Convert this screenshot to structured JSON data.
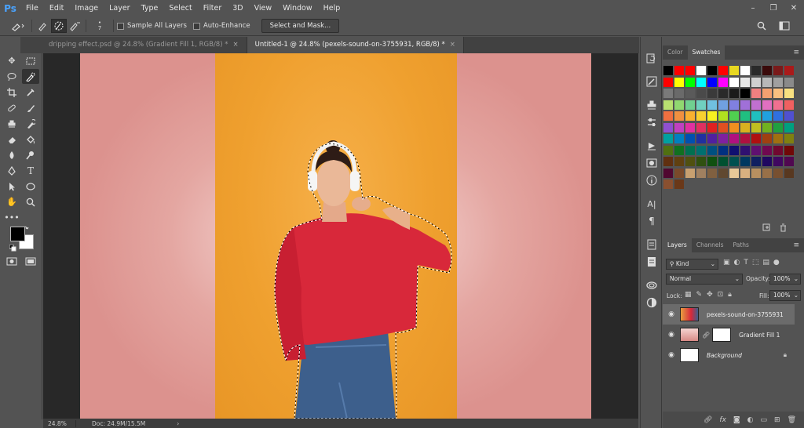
{
  "app": {
    "logo": "Ps"
  },
  "menu": [
    "File",
    "Edit",
    "Image",
    "Layer",
    "Type",
    "Select",
    "Filter",
    "3D",
    "View",
    "Window",
    "Help"
  ],
  "window_controls": {
    "minimize": "–",
    "restore": "❐",
    "close": "✕"
  },
  "options": {
    "brush_size": "7",
    "sample_all_layers": "Sample All Layers",
    "auto_enhance": "Auto-Enhance",
    "select_and_mask": "Select and Mask..."
  },
  "tabs": [
    {
      "label": "dripping effect.psd @ 24.8% (Gradient Fill 1, RGB/8) *",
      "close": "×"
    },
    {
      "label": "Untitled-1 @ 24.8% (pexels-sound-on-3755931, RGB/8) *",
      "close": "×"
    }
  ],
  "status": {
    "zoom": "24.8%",
    "doc": "Doc: 24.9M/15.5M",
    "arrow": "›"
  },
  "color_panel": {
    "tabs": [
      "Color",
      "Swatches"
    ],
    "active": "Swatches",
    "menu": "≡"
  },
  "swatch_colors": [
    [
      "#000000",
      "#ff0000",
      "#ff0000",
      "#ffffff",
      "#000000",
      "#ff0000",
      "#e8d820",
      "#ffffff",
      "#2a2a2a",
      "#3a0a0a",
      "#7a1a1a",
      "#aa1a1a"
    ],
    [
      "#ff0000",
      "#ffff00",
      "#00ff00",
      "#00ffff",
      "#0000ff",
      "#ff00ff",
      "#ffffff",
      "#e8e8e8",
      "#d0d0d0",
      "#b8b8b8",
      "#a0a0a0",
      "#8a8a8a"
    ],
    [
      "#7a7a7a",
      "#6a6a6a",
      "#5a5a5a",
      "#4a4a4a",
      "#3a3a3a",
      "#2a2a2a",
      "#1a1a1a",
      "#000000",
      "#f08080",
      "#f4a070",
      "#f8c080",
      "#f8e080"
    ],
    [
      "#b8e070",
      "#90d870",
      "#70d090",
      "#70d0c0",
      "#70c0e0",
      "#70a0e0",
      "#8080e0",
      "#a070d8",
      "#c070d0",
      "#e070c0",
      "#f07090",
      "#f06060"
    ],
    [
      "#f07040",
      "#f09040",
      "#f8b030",
      "#f8d030",
      "#f8f020",
      "#b0e020",
      "#50d050",
      "#20c080",
      "#20c0c0",
      "#20a0e0",
      "#3070e0",
      "#5050d0"
    ],
    [
      "#9050d0",
      "#c040c0",
      "#e030a0",
      "#e03060",
      "#e02020",
      "#e05020",
      "#f09020",
      "#d8b020",
      "#c0c020",
      "#70b020",
      "#20a040",
      "#00a080"
    ],
    [
      "#00a0a0",
      "#0080c0",
      "#0050b0",
      "#2030a0",
      "#5020a0",
      "#8020a0",
      "#b01080",
      "#b01040",
      "#b01010",
      "#a04010",
      "#a07010",
      "#808010"
    ],
    [
      "#507010",
      "#107020",
      "#007050",
      "#007070",
      "#005080",
      "#003080",
      "#101070",
      "#301070",
      "#601070",
      "#700850",
      "#700830",
      "#700808"
    ],
    [
      "#603010",
      "#604010",
      "#505010",
      "#305010",
      "#105010",
      "#005030",
      "#005050",
      "#003860",
      "#102060",
      "#200860",
      "#400860",
      "#500850"
    ],
    [
      "#500830",
      "#7a4a2a",
      "#c8a070",
      "#a08060",
      "#806040",
      "#604830",
      "#e8c898",
      "#d8b080",
      "#b89060",
      "#987048",
      "#785030",
      "#583820"
    ],
    [
      "#8a5030",
      "#6a3818"
    ]
  ],
  "layers_panel": {
    "tabs": [
      "Layers",
      "Channels",
      "Paths"
    ],
    "active": "Layers",
    "menu": "≡",
    "kind": "Kind",
    "blend_mode": "Normal",
    "opacity_label": "Opacity:",
    "opacity_value": "100%",
    "lock_label": "Lock:",
    "fill_label": "Fill:",
    "fill_value": "100%",
    "layers": [
      {
        "name": "pexels-sound-on-3755931",
        "selected": true
      },
      {
        "name": "Gradient Fill 1",
        "selected": false
      },
      {
        "name": "Background",
        "selected": false
      }
    ],
    "footer_icons": [
      "link-icon",
      "fx-icon",
      "mask-icon",
      "adjustment-icon",
      "folder-icon",
      "new-layer-icon",
      "trash-icon"
    ]
  }
}
